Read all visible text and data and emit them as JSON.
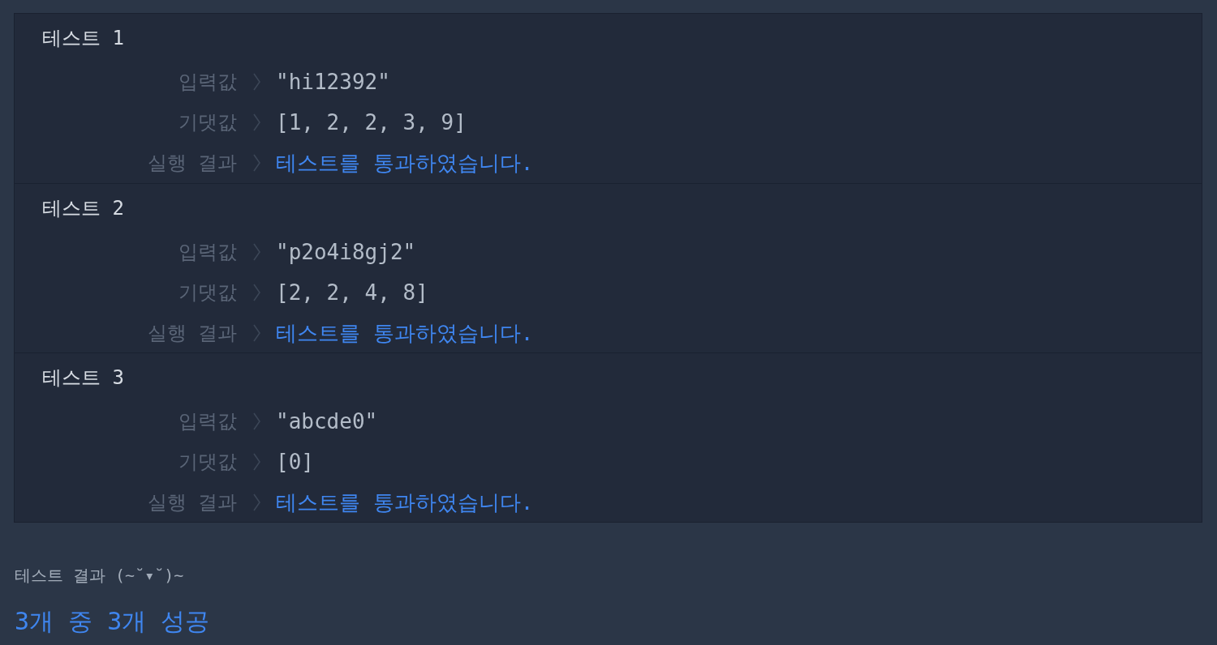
{
  "tests": [
    {
      "title": "테스트 1",
      "rows": [
        {
          "label": "입력값",
          "value": "\"hi12392\"",
          "kind": "value"
        },
        {
          "label": "기댓값",
          "value": "[1, 2, 2, 3, 9]",
          "kind": "value"
        },
        {
          "label": "실행 결과",
          "value": "테스트를 통과하였습니다.",
          "kind": "result"
        }
      ]
    },
    {
      "title": "테스트 2",
      "rows": [
        {
          "label": "입력값",
          "value": "\"p2o4i8gj2\"",
          "kind": "value"
        },
        {
          "label": "기댓값",
          "value": "[2, 2, 4, 8]",
          "kind": "value"
        },
        {
          "label": "실행 결과",
          "value": "테스트를 통과하였습니다.",
          "kind": "result"
        }
      ]
    },
    {
      "title": "테스트 3",
      "rows": [
        {
          "label": "입력값",
          "value": "\"abcde0\"",
          "kind": "value"
        },
        {
          "label": "기댓값",
          "value": "[0]",
          "kind": "value"
        },
        {
          "label": "실행 결과",
          "value": "테스트를 통과하였습니다.",
          "kind": "result"
        }
      ]
    }
  ],
  "summary": {
    "heading": "테스트 결과 (~˘▾˘)~",
    "result": "3개 중 3개 성공"
  }
}
